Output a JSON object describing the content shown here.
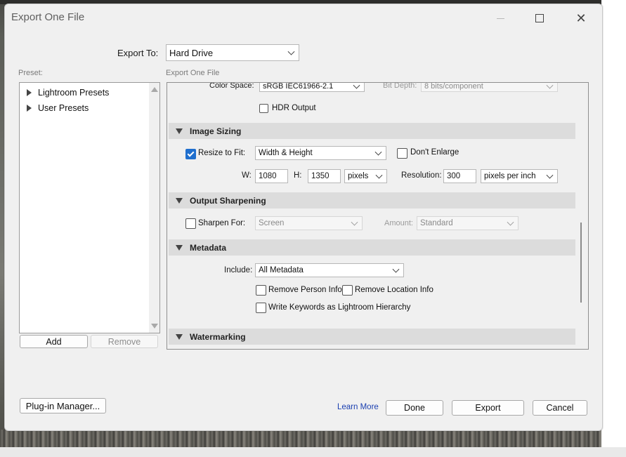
{
  "window": {
    "title": "Export One File"
  },
  "export_to": {
    "label": "Export To:",
    "value": "Hard Drive"
  },
  "preset": {
    "label": "Preset:",
    "items": [
      "Lightroom Presets",
      "User Presets"
    ],
    "add_label": "Add",
    "remove_label": "Remove"
  },
  "panel": {
    "label": "Export One File"
  },
  "file_settings": {
    "color_space_label": "Color Space:",
    "color_space_value": "sRGB IEC61966-2.1",
    "bit_depth_label": "Bit Depth:",
    "bit_depth_value": "8 bits/component",
    "hdr_label": "HDR Output",
    "hdr_checked": false
  },
  "image_sizing": {
    "header": "Image Sizing",
    "resize_label": "Resize to Fit:",
    "resize_checked": true,
    "resize_mode": "Width & Height",
    "dont_enlarge_label": "Don't Enlarge",
    "dont_enlarge_checked": false,
    "w_label": "W:",
    "w_value": "1080",
    "h_label": "H:",
    "h_value": "1350",
    "units": "pixels",
    "resolution_label": "Resolution:",
    "resolution_value": "300",
    "resolution_units": "pixels per inch"
  },
  "output_sharpening": {
    "header": "Output Sharpening",
    "sharpen_label": "Sharpen For:",
    "sharpen_checked": false,
    "sharpen_value": "Screen",
    "amount_label": "Amount:",
    "amount_value": "Standard"
  },
  "metadata": {
    "header": "Metadata",
    "include_label": "Include:",
    "include_value": "All Metadata",
    "remove_person_label": "Remove Person Info",
    "remove_location_label": "Remove Location Info",
    "write_keywords_label": "Write Keywords as Lightroom Hierarchy"
  },
  "watermarking": {
    "header": "Watermarking"
  },
  "footer": {
    "plugin_manager": "Plug-in Manager...",
    "learn_more": "Learn More",
    "done": "Done",
    "export": "Export",
    "cancel": "Cancel"
  },
  "colors": {
    "accent": "#1f6fce",
    "section_header": "#dcdcdc",
    "link": "#1a3fb0"
  }
}
